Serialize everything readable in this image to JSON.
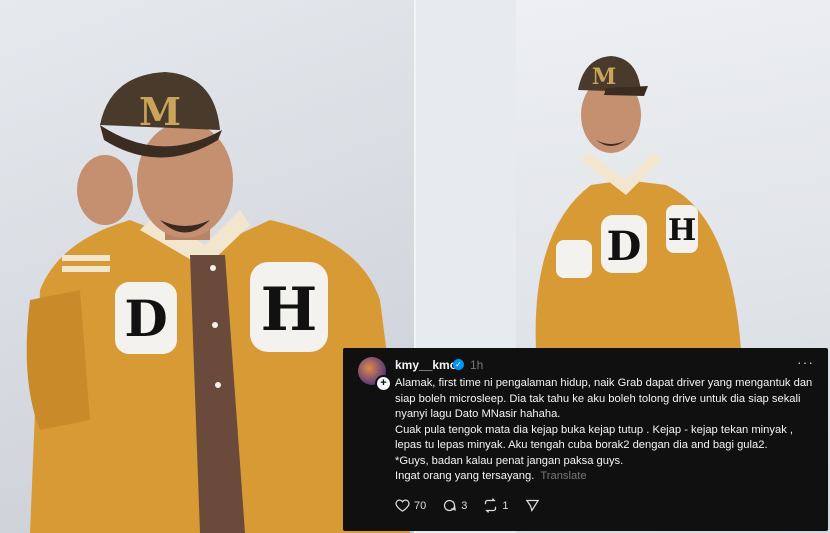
{
  "post": {
    "username": "kmy__kmo",
    "time": "1h",
    "more": "···",
    "paragraphs": [
      "Alamak, first time ni pengalaman hidup, naik Grab dapat driver yang mengantuk dan siap boleh microsleep. Dia tak tahu ke aku boleh tolong drive untuk dia siap sekali nyanyi lagu Dato MNasir hahaha.",
      "Cuak pula tengok mata dia kejap buka kejap tutup . Kejap - kejap tekan minyak , lepas tu lepas minyak. Aku tengah cuba borak2 dengan dia and bagi gula2.",
      "*Guys, badan kalau penat jangan paksa guys.",
      "Ingat orang yang tersayang."
    ],
    "translate": "Translate",
    "likes": "70",
    "comments": "3",
    "reposts": "1"
  },
  "icons": {
    "verified": "verified-badge-icon",
    "like": "heart-icon",
    "comment": "comment-icon",
    "repost": "repost-icon",
    "share": "send-icon"
  },
  "colors": {
    "card_bg": "#101010",
    "text": "#f3f5f7",
    "muted": "#777777",
    "verified": "#0095f6",
    "jacket": "#d89a35"
  }
}
